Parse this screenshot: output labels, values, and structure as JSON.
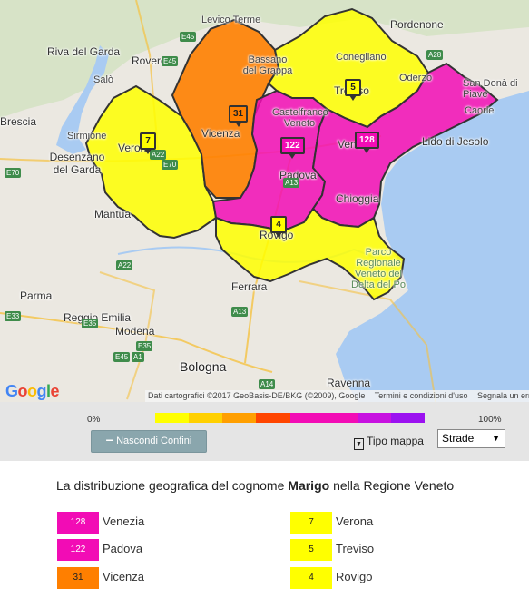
{
  "map": {
    "cities": [
      {
        "id": "levico",
        "name": "Levico Terme",
        "cls": "small"
      },
      {
        "id": "pordenone",
        "name": "Pordenone",
        "cls": ""
      },
      {
        "id": "riva",
        "name": "Riva del Garda",
        "cls": ""
      },
      {
        "id": "rovereto",
        "name": "Rovereto",
        "cls": ""
      },
      {
        "id": "salo",
        "name": "Salò",
        "cls": "small"
      },
      {
        "id": "bassano",
        "name": "Bassano del Grappa",
        "cls": "small"
      },
      {
        "id": "conegliano",
        "name": "Conegliano",
        "cls": "small"
      },
      {
        "id": "oderzo",
        "name": "Oderzo",
        "cls": "small"
      },
      {
        "id": "treviso",
        "name": "Treviso",
        "cls": ""
      },
      {
        "id": "sandona",
        "name": "San Donà di Piave",
        "cls": "small"
      },
      {
        "id": "brescia",
        "name": "Brescia",
        "cls": ""
      },
      {
        "id": "sirmione",
        "name": "Sirmione",
        "cls": "small"
      },
      {
        "id": "verona",
        "name": "Verona",
        "cls": ""
      },
      {
        "id": "vicenza",
        "name": "Vicenza",
        "cls": ""
      },
      {
        "id": "castelfranco",
        "name": "Castelfranco Veneto",
        "cls": "small"
      },
      {
        "id": "jesolo",
        "name": "Lido di Jesolo",
        "cls": ""
      },
      {
        "id": "caorle",
        "name": "Caorle",
        "cls": "small"
      },
      {
        "id": "desenzano",
        "name": "Desenzano del Garda",
        "cls": ""
      },
      {
        "id": "padova",
        "name": "Padova",
        "cls": ""
      },
      {
        "id": "venezia",
        "name": "Venezia",
        "cls": ""
      },
      {
        "id": "chioggia",
        "name": "Chioggia",
        "cls": ""
      },
      {
        "id": "mantua",
        "name": "Mantua",
        "cls": ""
      },
      {
        "id": "rovigo",
        "name": "Rovigo",
        "cls": ""
      },
      {
        "id": "delta",
        "name": "Parco Regionale Veneto del Delta del Po",
        "cls": "small"
      },
      {
        "id": "parma",
        "name": "Parma",
        "cls": ""
      },
      {
        "id": "ferrara",
        "name": "Ferrara",
        "cls": ""
      },
      {
        "id": "reggio",
        "name": "Reggio Emilia",
        "cls": ""
      },
      {
        "id": "modena",
        "name": "Modena",
        "cls": ""
      },
      {
        "id": "bologna",
        "name": "Bologna",
        "cls": "big"
      },
      {
        "id": "ravenna",
        "name": "Ravenna",
        "cls": ""
      }
    ],
    "highways": [
      "E45",
      "E45",
      "A28",
      "A22",
      "E70",
      "E70",
      "A13",
      "A22",
      "E33",
      "E35",
      "E35",
      "A1",
      "A13",
      "E45",
      "A14"
    ],
    "markers": [
      {
        "province": "Vicenza",
        "value": "31",
        "color": "#ff7f00",
        "text": "#222"
      },
      {
        "province": "Treviso",
        "value": "5",
        "color": "#ffff00",
        "text": "#222"
      },
      {
        "province": "Verona",
        "value": "7",
        "color": "#ffff00",
        "text": "#222"
      },
      {
        "province": "Padova",
        "value": "122",
        "color": "#f20cb5",
        "text": "#fff"
      },
      {
        "province": "Venezia",
        "value": "128",
        "color": "#f20cb5",
        "text": "#fff"
      },
      {
        "province": "Rovigo",
        "value": "4",
        "color": "#ffff00",
        "text": "#222"
      }
    ],
    "google_logo": "Google",
    "attribution": {
      "data": "Dati cartografici ©2017 GeoBasis-DE/BKG (©2009), Google",
      "terms": "Termini e condizioni d'uso",
      "report": "Segnala un errore nella mappa"
    }
  },
  "controls": {
    "min_label": "0%",
    "max_label": "100%",
    "scale_colors": [
      "#ffff00",
      "#ffd000",
      "#ff9f00",
      "#ff4500",
      "#f20cb5",
      "#f20cb5",
      "#c711e0",
      "#9b11f0"
    ],
    "borders_button": "Nascondi Confini",
    "map_type_label": "Tipo mappa",
    "map_type_value": "Strade"
  },
  "caption": {
    "prefix": "La distribuzione geografica del cognome",
    "surname": "Marigo",
    "suffix": "nella Regione Veneto"
  },
  "legend": [
    {
      "value": "128",
      "name": "Venezia",
      "color": "#f20cb5",
      "text": "#fff"
    },
    {
      "value": "7",
      "name": "Verona",
      "color": "#ffff00",
      "text": "#222"
    },
    {
      "value": "122",
      "name": "Padova",
      "color": "#f20cb5",
      "text": "#fff"
    },
    {
      "value": "5",
      "name": "Treviso",
      "color": "#ffff00",
      "text": "#222"
    },
    {
      "value": "31",
      "name": "Vicenza",
      "color": "#ff7f00",
      "text": "#222"
    },
    {
      "value": "4",
      "name": "Rovigo",
      "color": "#ffff00",
      "text": "#222"
    }
  ]
}
